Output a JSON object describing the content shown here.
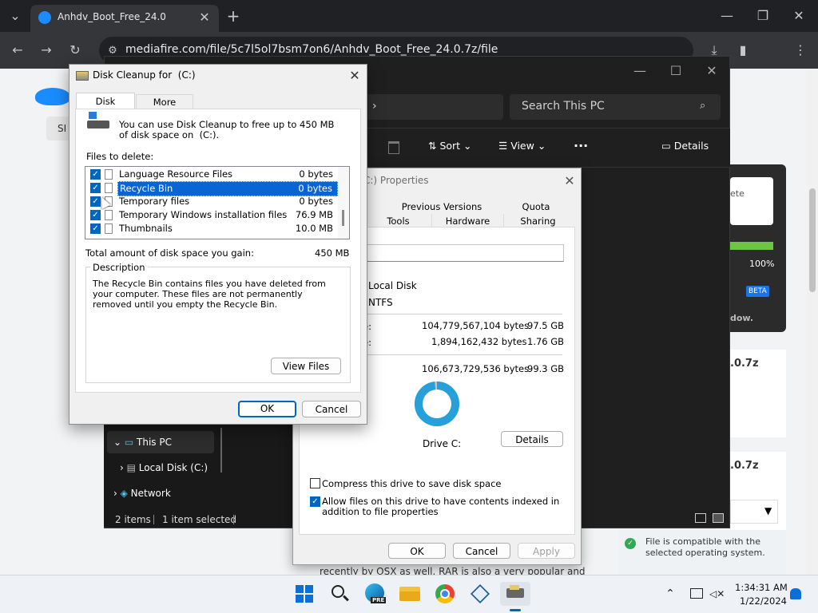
{
  "browser": {
    "tab_title": "Anhdv_Boot_Free_24.0",
    "url": "mediafire.com/file/5c7l5ol7bsm7on6/Anhdv_Boot_Free_24.0.7z/file"
  },
  "webpage": {
    "sign_text": "SI",
    "right_white_text": "ete",
    "progress_pct": "100%",
    "beta_badge": "BETA",
    "dow_text": "dow.",
    "card1_text": ".0.7z",
    "card2_text": ".0.7z",
    "compat_text": "File is compatible with the selected operating system.",
    "bottom_text": "recently by OSX as well. RAR is also a very popular and"
  },
  "explorer": {
    "search_placeholder": "Search This PC",
    "sort_label": "Sort",
    "view_label": "View",
    "more_label": "···",
    "details_label": "Details",
    "nav_this_pc": "This PC",
    "nav_local_disk": "Local Disk (C:)",
    "nav_network": "Network",
    "status_items": "2 items",
    "status_selected": "1 item selected"
  },
  "properties": {
    "title": "C:) Properties",
    "tabs_row1": [
      "Previous Versions",
      "Quota"
    ],
    "tabs_row2": [
      "Tools",
      "Hardware",
      "Sharing"
    ],
    "type_value": "Local Disk",
    "fs_value": "NTFS",
    "used_label": "e:",
    "used_bytes": "104,779,567,104 bytes",
    "used_gb": "97.5 GB",
    "free_label": "e:",
    "free_bytes": "1,894,162,432 bytes",
    "free_gb": "1.76 GB",
    "cap_bytes": "106,673,729,536 bytes",
    "cap_gb": "99.3 GB",
    "drive_label": "Drive C:",
    "details_btn": "Details",
    "compress_label": "Compress this drive to save disk space",
    "index_label": "Allow files on this drive to have contents indexed in addition to file properties",
    "ok": "OK",
    "cancel": "Cancel",
    "apply": "Apply",
    "used_fraction": 0.982
  },
  "disk_cleanup": {
    "title": "Disk Cleanup for  (C:)",
    "tab_cleanup": "Disk Cleanup",
    "tab_more": "More Options",
    "intro": "You can use Disk Cleanup to free up to 450 MB of disk space on  (C:).",
    "files_label": "Files to delete:",
    "files": [
      {
        "name": "Language Resource Files",
        "size": "0 bytes",
        "checked": true,
        "selected": false
      },
      {
        "name": "Recycle Bin",
        "size": "0 bytes",
        "checked": true,
        "selected": true
      },
      {
        "name": "Temporary files",
        "size": "0 bytes",
        "checked": true,
        "selected": false
      },
      {
        "name": "Temporary Windows installation files",
        "size": "76.9 MB",
        "checked": true,
        "selected": false
      },
      {
        "name": "Thumbnails",
        "size": "10.0 MB",
        "checked": true,
        "selected": false
      }
    ],
    "total_label": "Total amount of disk space you gain:",
    "total_value": "450 MB",
    "desc_label": "Description",
    "desc_text": "The Recycle Bin contains files you have deleted from your computer. These files are not permanently removed until you empty the Recycle Bin.",
    "view_files": "View Files",
    "ok": "OK",
    "cancel": "Cancel"
  },
  "taskbar": {
    "time": "1:34:31 AM",
    "date": "1/22/2024",
    "pre_badge": "PRE"
  },
  "colors": {
    "accent": "#0067c0",
    "selection": "#0a64d6",
    "browser_dark": "#202124",
    "explorer_dark": "#1f1f1f",
    "donut": "#26a0da"
  }
}
